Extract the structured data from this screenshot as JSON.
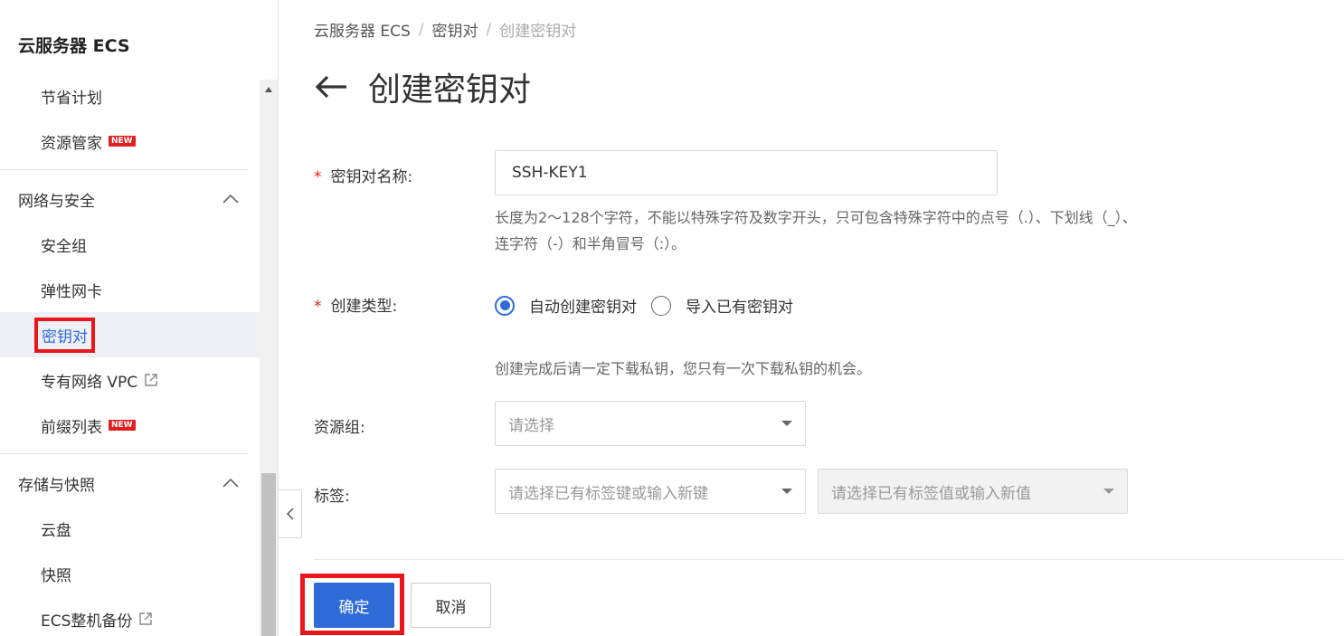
{
  "sidebar": {
    "title": "云服务器 ECS",
    "items_top": [
      {
        "label": "节省计划",
        "badge": ""
      },
      {
        "label": "资源管家",
        "badge": "NEW"
      }
    ],
    "section_network": {
      "label": "网络与安全",
      "expanded": true,
      "items": [
        {
          "label": "安全组"
        },
        {
          "label": "弹性网卡"
        },
        {
          "label": "密钥对",
          "active": true
        },
        {
          "label": "专有网络 VPC",
          "external": true
        },
        {
          "label": "前缀列表",
          "badge": "NEW"
        }
      ]
    },
    "section_storage": {
      "label": "存储与快照",
      "expanded": true,
      "items": [
        {
          "label": "云盘"
        },
        {
          "label": "快照"
        },
        {
          "label": "ECS整机备份",
          "external": true
        }
      ]
    }
  },
  "breadcrumb": {
    "items": [
      "云服务器 ECS",
      "密钥对",
      "创建密钥对"
    ],
    "separator": "/"
  },
  "page": {
    "title": "创建密钥对"
  },
  "form": {
    "name": {
      "label": "密钥对名称:",
      "required_mark": "*",
      "value": "SSH-KEY1",
      "hint_line1": "长度为2～128个字符，不能以特殊字符及数字开头，只可包含特殊字符中的点号（.）、下划线（_）、",
      "hint_line2": "连字符（-）和半角冒号（:）。"
    },
    "create_type": {
      "label": "创建类型:",
      "required_mark": "*",
      "options": [
        "自动创建密钥对",
        "导入已有密钥对"
      ],
      "selected": 0,
      "hint": "创建完成后请一定下载私钥，您只有一次下载私钥的机会。"
    },
    "resource_group": {
      "label": "资源组:",
      "placeholder": "请选择"
    },
    "tags": {
      "label": "标签:",
      "key_placeholder": "请选择已有标签键或输入新键",
      "value_placeholder": "请选择已有标签值或输入新值",
      "value_disabled": true
    }
  },
  "actions": {
    "ok_label": "确定",
    "cancel_label": "取消"
  },
  "colors": {
    "primary": "#2f6bd6",
    "highlight_frame": "#e8171b",
    "badge_new": "#e02020",
    "active_bg": "#eef0f5"
  }
}
